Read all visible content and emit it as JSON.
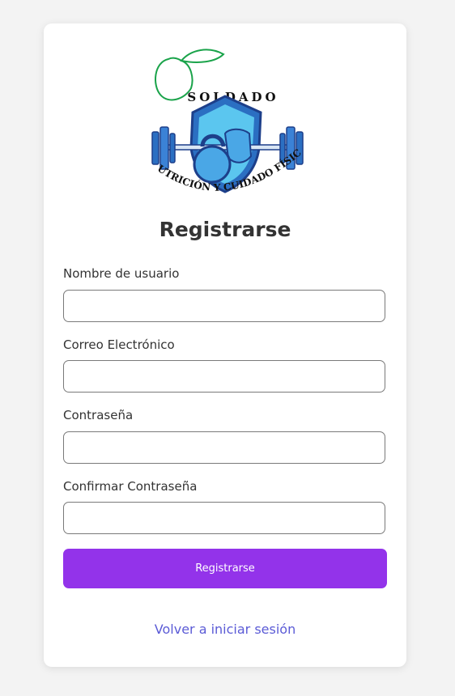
{
  "logo": {
    "top_text": "SOLDADO",
    "bottom_text": "NUTRICIÓN Y CUIDADO FÍSICO"
  },
  "form": {
    "title": "Registrarse",
    "fields": [
      {
        "label": "Nombre de usuario",
        "value": "",
        "placeholder": ""
      },
      {
        "label": "Correo Electrónico",
        "value": "",
        "placeholder": ""
      },
      {
        "label": "Contraseña",
        "value": "",
        "placeholder": ""
      },
      {
        "label": "Confirmar Contraseña",
        "value": "",
        "placeholder": ""
      }
    ],
    "submit_label": "Registrarse",
    "back_link": "Volver a iniciar sesión"
  },
  "colors": {
    "accent": "#9333ea",
    "link": "#5b5bd6",
    "background": "#f3f3f3",
    "card": "#ffffff"
  }
}
